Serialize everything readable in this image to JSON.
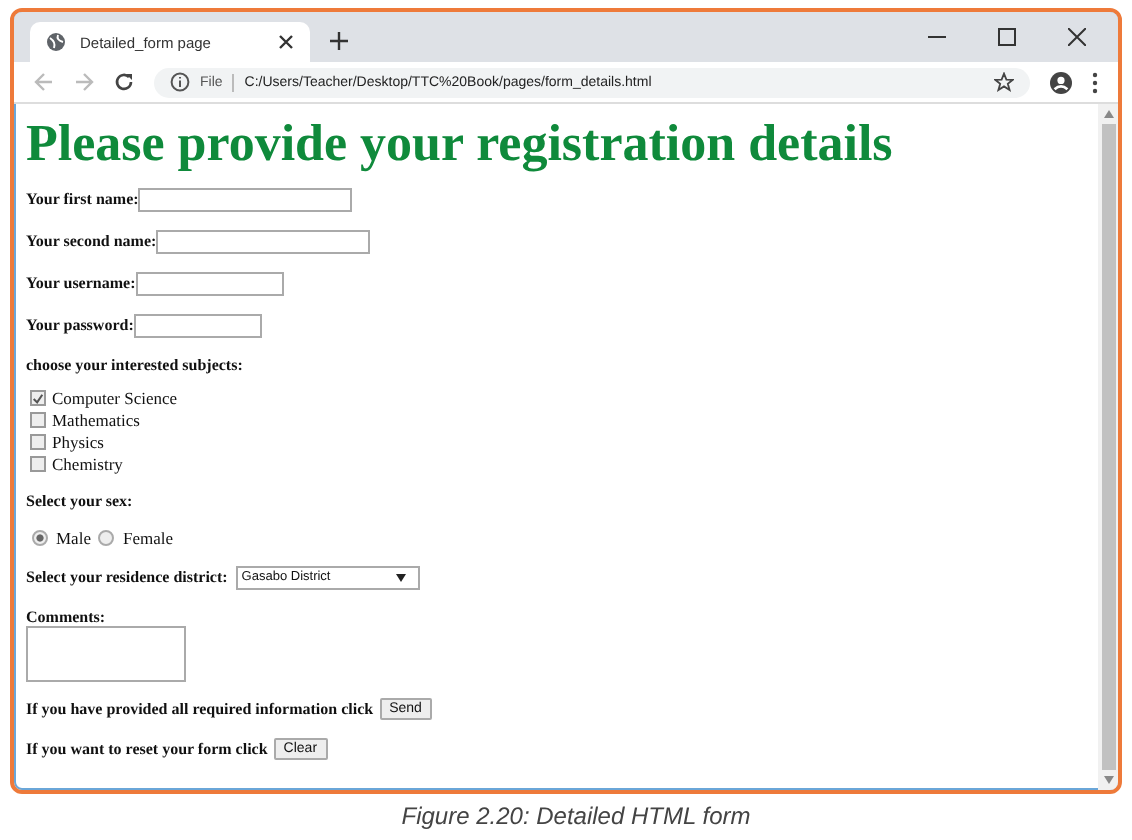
{
  "browser": {
    "tab_title": "Detailed_form page",
    "address": "C:/Users/Teacher/Desktop/TTC%20Book/pages/form_details.html",
    "address_prefix": "File"
  },
  "page": {
    "heading": "Please provide your registration details",
    "text_fields": [
      {
        "label": "Your first name:"
      },
      {
        "label": "Your second name:"
      },
      {
        "label": "Your username:"
      },
      {
        "label": "Your password:"
      }
    ],
    "subjects_label": "choose your interested subjects:",
    "subjects": [
      {
        "label": "Computer Science",
        "checked": true
      },
      {
        "label": "Mathematics",
        "checked": false
      },
      {
        "label": "Physics",
        "checked": false
      },
      {
        "label": "Chemistry",
        "checked": false
      }
    ],
    "sex_label": "Select your sex:",
    "sexes": [
      {
        "label": "Male",
        "selected": true
      },
      {
        "label": "Female",
        "selected": false
      }
    ],
    "district_label": "Select your residence district:",
    "district_value": "Gasabo District",
    "comments_label": "Comments:",
    "send_text": "If you have provided all required information click",
    "send_button": "Send",
    "reset_text": "If you want to reset your form click",
    "reset_button": "Clear"
  },
  "caption": "Figure 2.20: Detailed HTML form"
}
